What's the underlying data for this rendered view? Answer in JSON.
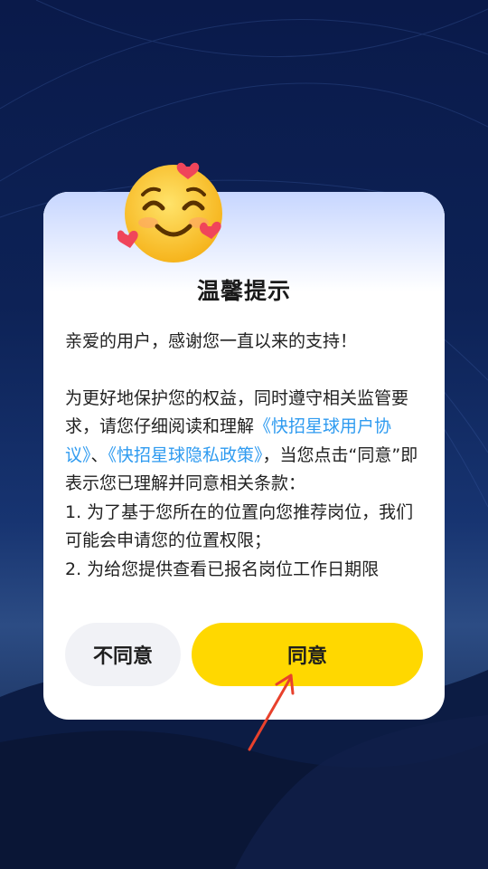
{
  "dialog": {
    "title": "温馨提示",
    "greeting": "亲爱的用户，感谢您一直以来的支持！",
    "para_intro": "为更好地保护您的权益，同时遵守相关监管要求，请您仔细阅读和理解",
    "link_user_agreement": "《快招星球用户协议》",
    "separator": "、",
    "link_privacy_policy": "《快招星球隐私政策》",
    "para_after_links": "，当您点击“同意”即表示您已理解并同意相关条款：",
    "item_1": "1. 为了基于您所在的位置向您推荐岗位，我们可能会申请您的位置权限；",
    "item_2": "2. 为给您提供查看已报名岗位工作日期限"
  },
  "buttons": {
    "disagree_label": "不同意",
    "agree_label": "同意"
  },
  "colors": {
    "link": "#2f9bf0",
    "agree_button": "#ffd800",
    "disagree_button": "#f1f2f6",
    "arrow": "#e8412c"
  },
  "icons": [
    "smiling-face-with-hearts-icon",
    "annotation-arrow-icon"
  ]
}
